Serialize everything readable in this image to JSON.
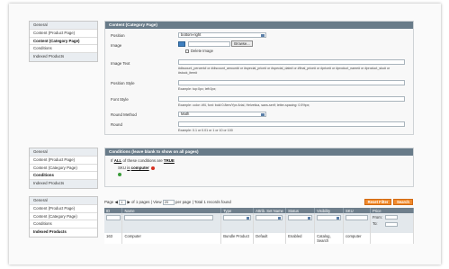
{
  "colors": {
    "panel_header": "#687b89",
    "grid_header": "#6f7f8c",
    "accent_button": "#f18a2c",
    "active_tab_bg": "#ffffff"
  },
  "tab_groups": [
    {
      "tabs": [
        {
          "label": "General",
          "active": false
        },
        {
          "label": "Content (Product Page)",
          "active": false
        },
        {
          "label": "Content (Category Page)",
          "active": true
        },
        {
          "label": "Conditions",
          "active": false
        },
        {
          "label": "Indexed Products",
          "active": false
        }
      ]
    },
    {
      "tabs": [
        {
          "label": "General",
          "active": false
        },
        {
          "label": "Content (Product Page)",
          "active": false
        },
        {
          "label": "Content (Category Page)",
          "active": false
        },
        {
          "label": "Conditions",
          "active": true
        },
        {
          "label": "Indexed Products",
          "active": false
        }
      ]
    },
    {
      "tabs": [
        {
          "label": "General",
          "active": false
        },
        {
          "label": "Content (Product Page)",
          "active": false
        },
        {
          "label": "Content (Category Page)",
          "active": false
        },
        {
          "label": "Conditions",
          "active": false
        },
        {
          "label": "Indexed Products",
          "active": true
        }
      ]
    }
  ],
  "content_panel": {
    "title": "Content (Category Page)",
    "position": {
      "label": "Position",
      "value": "bottom-right"
    },
    "image": {
      "label": "Image",
      "browse_label": "Browse...",
      "delete_label": "Delete Image"
    },
    "image_text": {
      "label": "Image Text",
      "note": "#discount_percent# or #discount_amount# or #special_price# or #special_date# or #final_price# or #price# or #product_name# or #product_sku# or #stock_item#"
    },
    "position_style": {
      "label": "Position Style",
      "note": "Example: top:0px; left:0px;"
    },
    "font_style": {
      "label": "Font Style",
      "note": "Example: color: #f4, font: bold 0.8em/Ypx Arial, Helvetica, sans-serif; letter-spacing: 0.5%px;"
    },
    "round_method": {
      "label": "Round Method",
      "value": "Math"
    },
    "round": {
      "label": "Round",
      "note": "Example: 0.1 or 0.01 or 1 or 10 or 100"
    }
  },
  "conditions_panel": {
    "title": "Conditions (leave blank to show on all pages)",
    "line1_prefix": "If",
    "line1_all": "ALL",
    "line1_mid": "of these conditions are",
    "line1_true": "TRUE",
    "line2_attr": "SKU",
    "line2_op": "is",
    "line2_value": "computer"
  },
  "grid": {
    "page_label": "Page",
    "page_value": "1",
    "of_pages": "of 1 pages",
    "view_label": "View",
    "view_value": "20",
    "per_page": "per page",
    "total": "Total 1 records found",
    "reset_label": "Reset Filter",
    "search_label": "Search",
    "columns": [
      "ID",
      "Name",
      "Type",
      "Attrib. Set Name",
      "Status",
      "Visibility",
      "SKU",
      "Price"
    ],
    "price_from": "From:",
    "price_to": "To:",
    "rows": [
      [
        "163",
        "Computer",
        "Bundle Product",
        "Default",
        "Enabled",
        "Catalog, Search",
        "computer",
        ""
      ]
    ]
  }
}
